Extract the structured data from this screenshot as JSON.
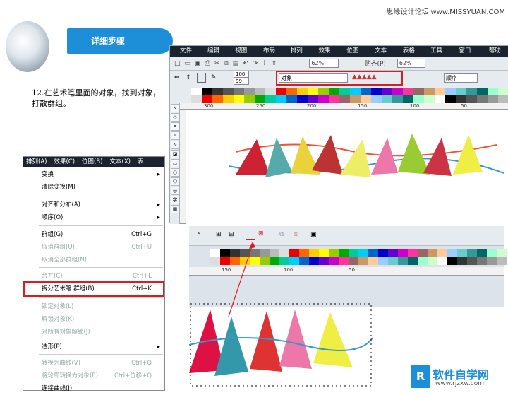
{
  "watermark": "思缘设计论坛 www.MISSYUAN.COM",
  "banner": {
    "title": "详细步骤"
  },
  "step": {
    "text": "12.在艺术笔里面的对象，找到对象，打散群组。"
  },
  "menubar": [
    "文件(F)",
    "编辑(E)",
    "视图(V)",
    "布局(L)",
    "排列(A)",
    "效果(C)",
    "位图(B)",
    "文本(X)",
    "表格(T)",
    "工具(O)",
    "窗口(W)",
    "帮助(H)"
  ],
  "toolbar1": {
    "zoom": "62%",
    "snap": "贴齐(P)",
    "zoom2": "62%"
  },
  "toolbar2": {
    "size1": "100",
    "size2": "99",
    "object_dropdown": "对象",
    "order_dropdown": "顺序"
  },
  "ruler1": [
    "300",
    "250",
    "200",
    "150",
    "100",
    "50"
  ],
  "ruler2": [
    "150",
    "100",
    "50"
  ],
  "tools": [
    "字"
  ],
  "context_menu": {
    "top": [
      "排列(A)",
      "效果(C)",
      "位图(B)",
      "文本(X)",
      "表"
    ],
    "items": [
      {
        "label": "变换",
        "arrow": "▸",
        "dis": false
      },
      {
        "label": "清除变换(M)",
        "dis": false
      },
      {
        "label": "对齐和分布(A)",
        "arrow": "▸",
        "dis": false
      },
      {
        "label": "顺序(O)",
        "arrow": "▸",
        "dis": false
      },
      {
        "label": "群组(G)",
        "sc": "Ctrl+G",
        "dis": false
      },
      {
        "label": "取消群组(U)",
        "sc": "Ctrl+U",
        "dis": true
      },
      {
        "label": "取消全部群组(N)",
        "dis": true
      },
      {
        "label": "合并(C)",
        "sc": "Ctrl+L",
        "dis": true
      },
      {
        "label": "拆分艺术笔 群组(B)",
        "sc": "Ctrl+K",
        "dis": false
      },
      {
        "label": "锁定对象(L)",
        "dis": true
      },
      {
        "label": "解锁对象(K)",
        "dis": true
      },
      {
        "label": "对所有对象解锁(J)",
        "dis": true
      },
      {
        "label": "造形(P)",
        "arrow": "▸",
        "dis": false
      },
      {
        "label": "转换为曲线(V)",
        "sc": "Ctrl+Q",
        "dis": true
      },
      {
        "label": "将轮廓转换为对象(E)",
        "sc": "Ctrl+位移+Q",
        "dis": true
      },
      {
        "label": "连接曲线(J)",
        "dis": false
      }
    ]
  },
  "logo": {
    "brand": "软件自学网",
    "url": "www.rjzxw.com"
  },
  "colors": {
    "accent": "#1d8fd8",
    "highlight": "#d62020",
    "menubar": "#1b2330"
  }
}
